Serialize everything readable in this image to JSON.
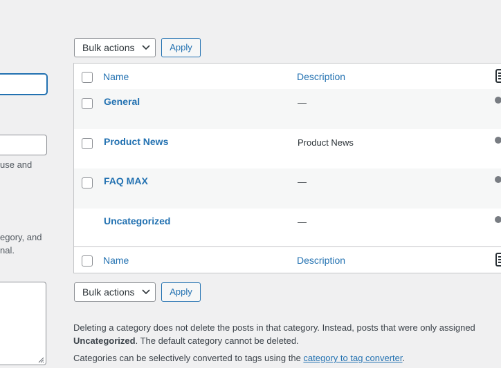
{
  "form": {
    "slug_help": "use and",
    "parent_help_line1": "egory, and",
    "parent_help_line2": "nal."
  },
  "bulk": {
    "select_label": "Bulk actions",
    "apply_label": "Apply"
  },
  "table": {
    "headers": {
      "name": "Name",
      "description": "Description"
    },
    "rows": [
      {
        "name": "General",
        "description": "—"
      },
      {
        "name": "Product News",
        "description": "Product News"
      },
      {
        "name": "FAQ MAX",
        "description": "—"
      },
      {
        "name": "Uncategorized",
        "description": "—"
      }
    ]
  },
  "notes": {
    "delete_text": "Deleting a category does not delete the posts in that category. Instead, posts that were only assigned",
    "uncategorized": "Uncategorized",
    "default_text": ". The default category cannot be deleted.",
    "convert_text": "Categories can be selectively converted to tags using the ",
    "convert_link": "category to tag converter",
    "convert_end": "."
  },
  "icons": {
    "select_chevron": "chevron-down-icon",
    "columns_toggle": "columns-icon",
    "row_status": "status-dot-icon",
    "textarea_grip": "resize-grip-icon"
  },
  "colors": {
    "accent": "#2271b1",
    "background": "#f0f0f1",
    "border": "#c3c4c7"
  }
}
